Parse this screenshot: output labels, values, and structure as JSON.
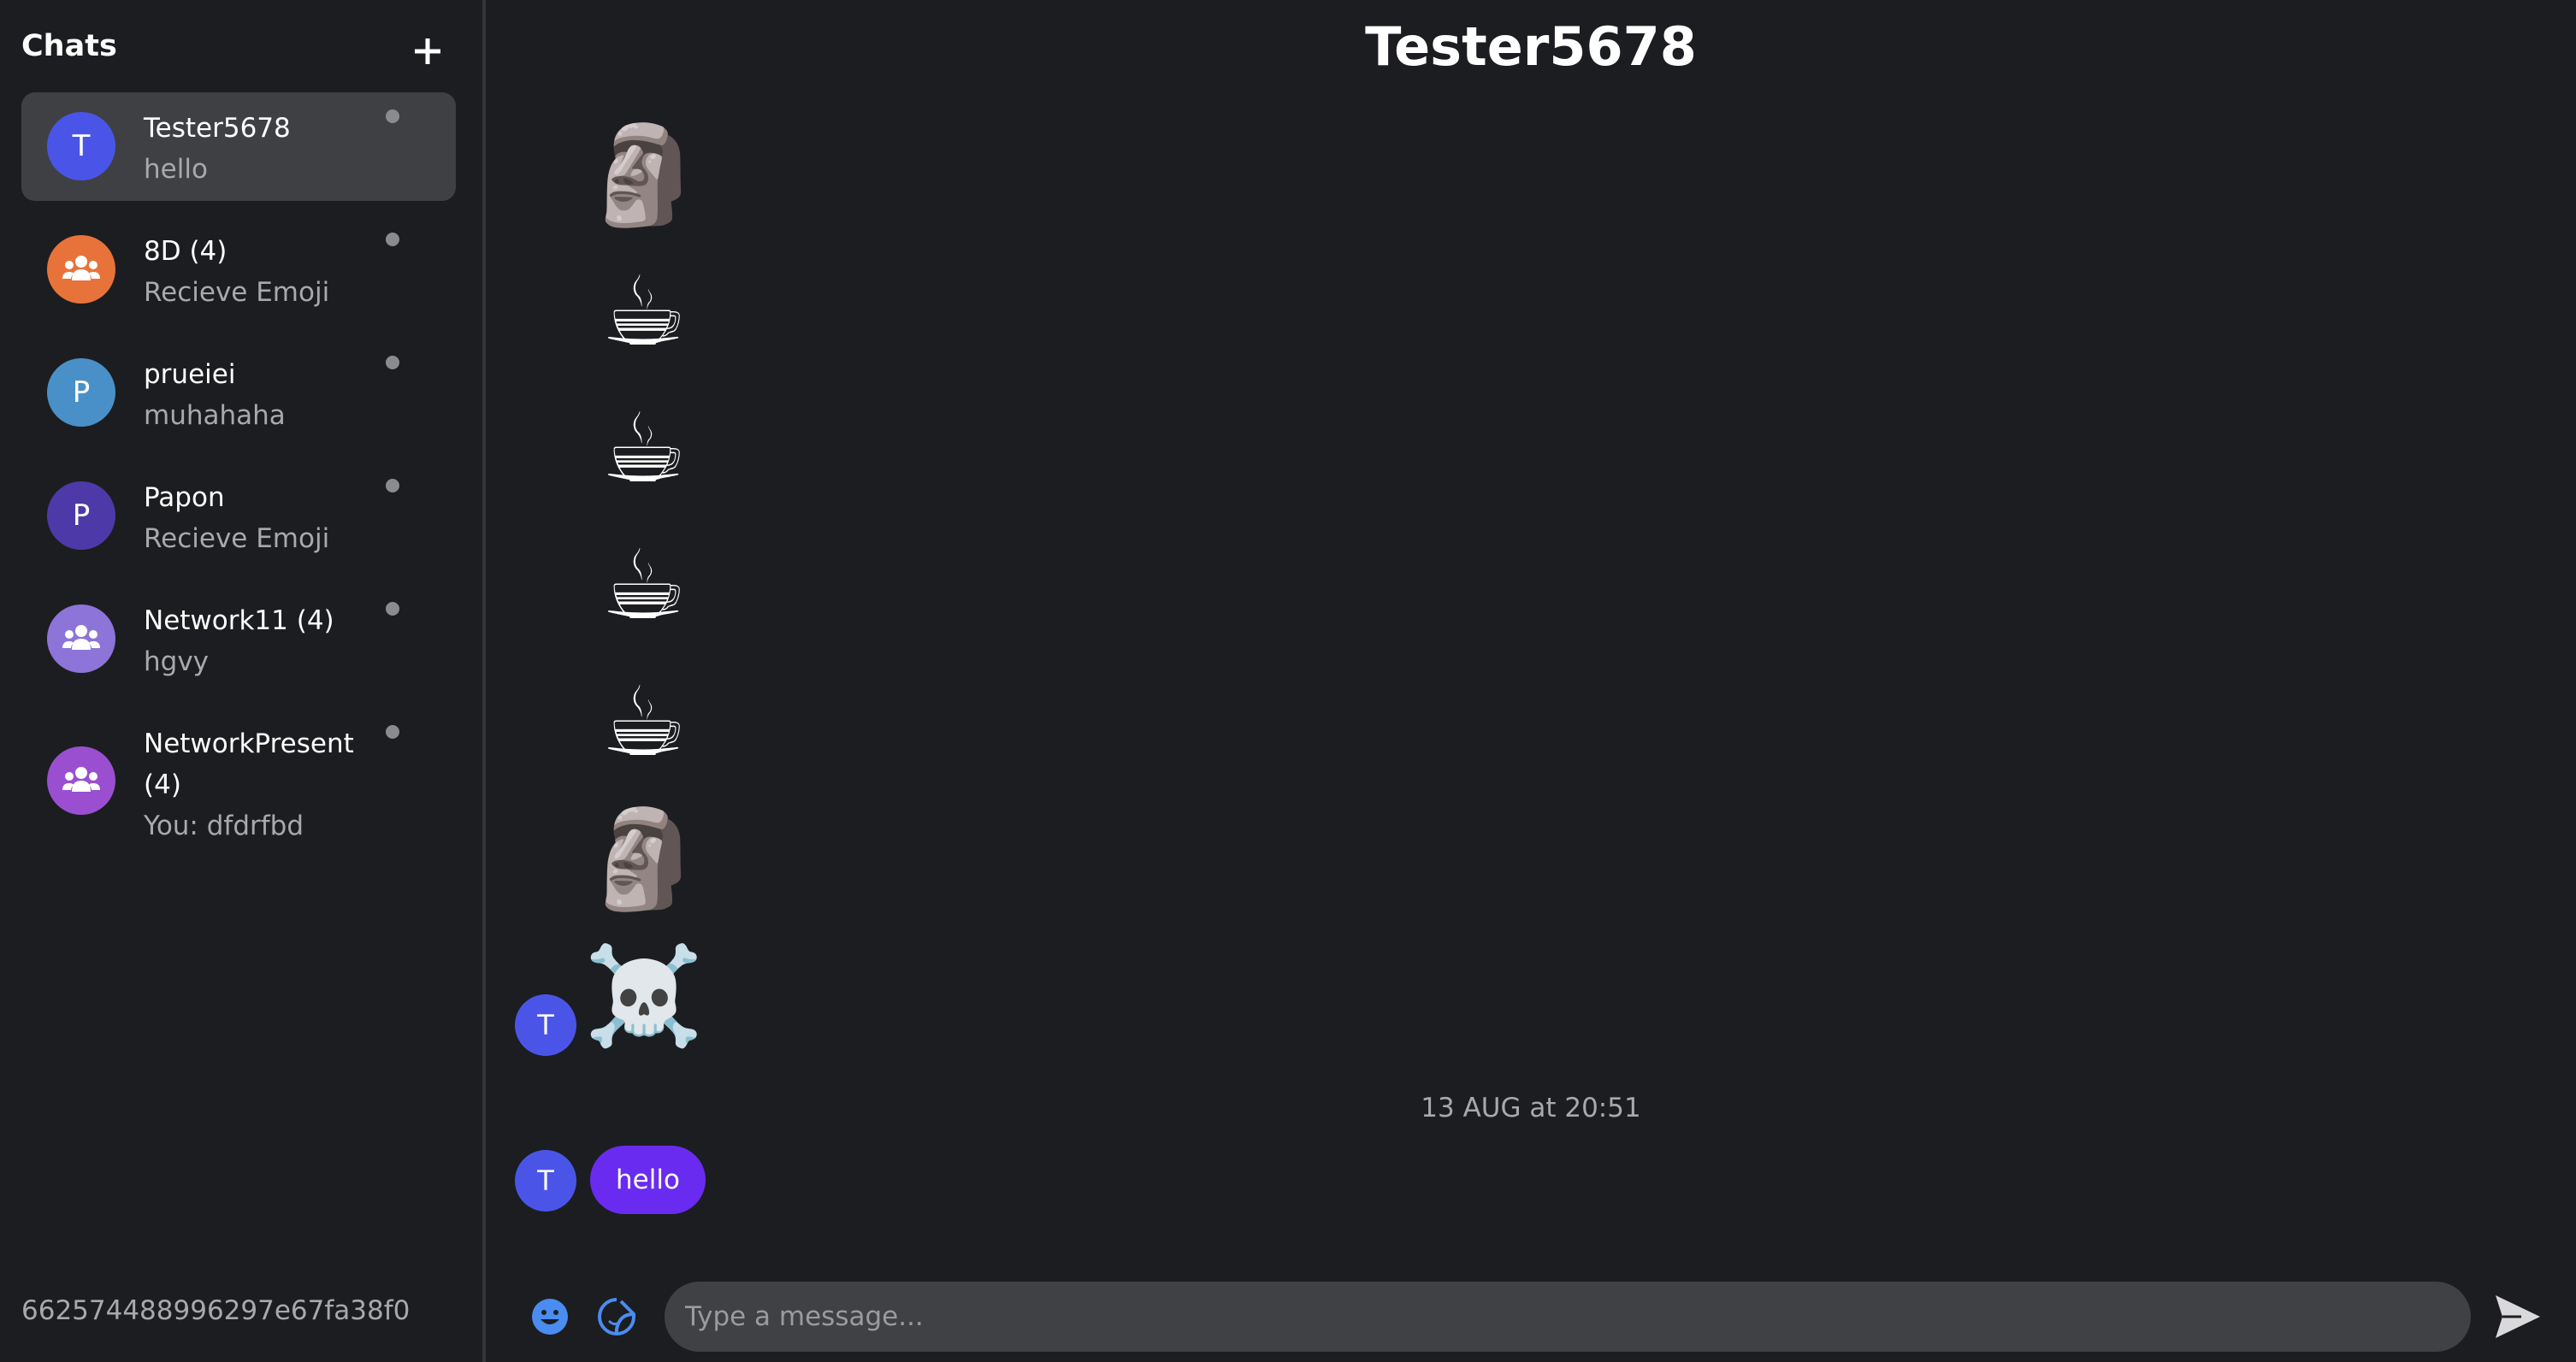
{
  "sidebar": {
    "title": "Chats",
    "new_chat_icon": "plus-icon",
    "chats": [
      {
        "name": "Tester5678",
        "preview": "hello",
        "avatar_letter": "T",
        "avatar_color": "#4a55e8",
        "avatar_icon": null,
        "active": true
      },
      {
        "name": "8D (4)",
        "preview": "Recieve Emoji",
        "avatar_letter": "",
        "avatar_color": "#e8733a",
        "avatar_icon": "group-icon",
        "active": false
      },
      {
        "name": "prueiei",
        "preview": "muhahaha",
        "avatar_letter": "P",
        "avatar_color": "#4a90c8",
        "avatar_icon": null,
        "active": false
      },
      {
        "name": "Papon",
        "preview": "Recieve Emoji",
        "avatar_letter": "P",
        "avatar_color": "#4d3aa8",
        "avatar_icon": null,
        "active": false
      },
      {
        "name": "Network11 (4)",
        "preview": "hgvy",
        "avatar_letter": "",
        "avatar_color": "#8d74d8",
        "avatar_icon": "group-icon",
        "active": false
      },
      {
        "name": "NetworkPresent (4)",
        "preview": "You: dfdrfbd",
        "avatar_letter": "",
        "avatar_color": "#9a4fd0",
        "avatar_icon": "group-icon",
        "active": false
      }
    ],
    "user_id": "662574488996297e67fa38f0"
  },
  "conversation": {
    "title": "Tester5678",
    "emoji_messages": [
      "🗿",
      "☕",
      "☕",
      "☕",
      "☕",
      "🗿",
      "☠️"
    ],
    "sender_avatar_letter": "T",
    "timestamp": "13 AUG at 20:51",
    "text_message": "hello"
  },
  "composer": {
    "placeholder": "Type a message...",
    "emoji_icon": "smiley-icon",
    "sticker_icon": "sticker-icon",
    "send_icon": "send-icon"
  },
  "colors": {
    "background": "#1c1d20",
    "active_chat": "#3f4044",
    "bubble": "#6a2bf0",
    "accent_icon": "#4a8cf0"
  }
}
